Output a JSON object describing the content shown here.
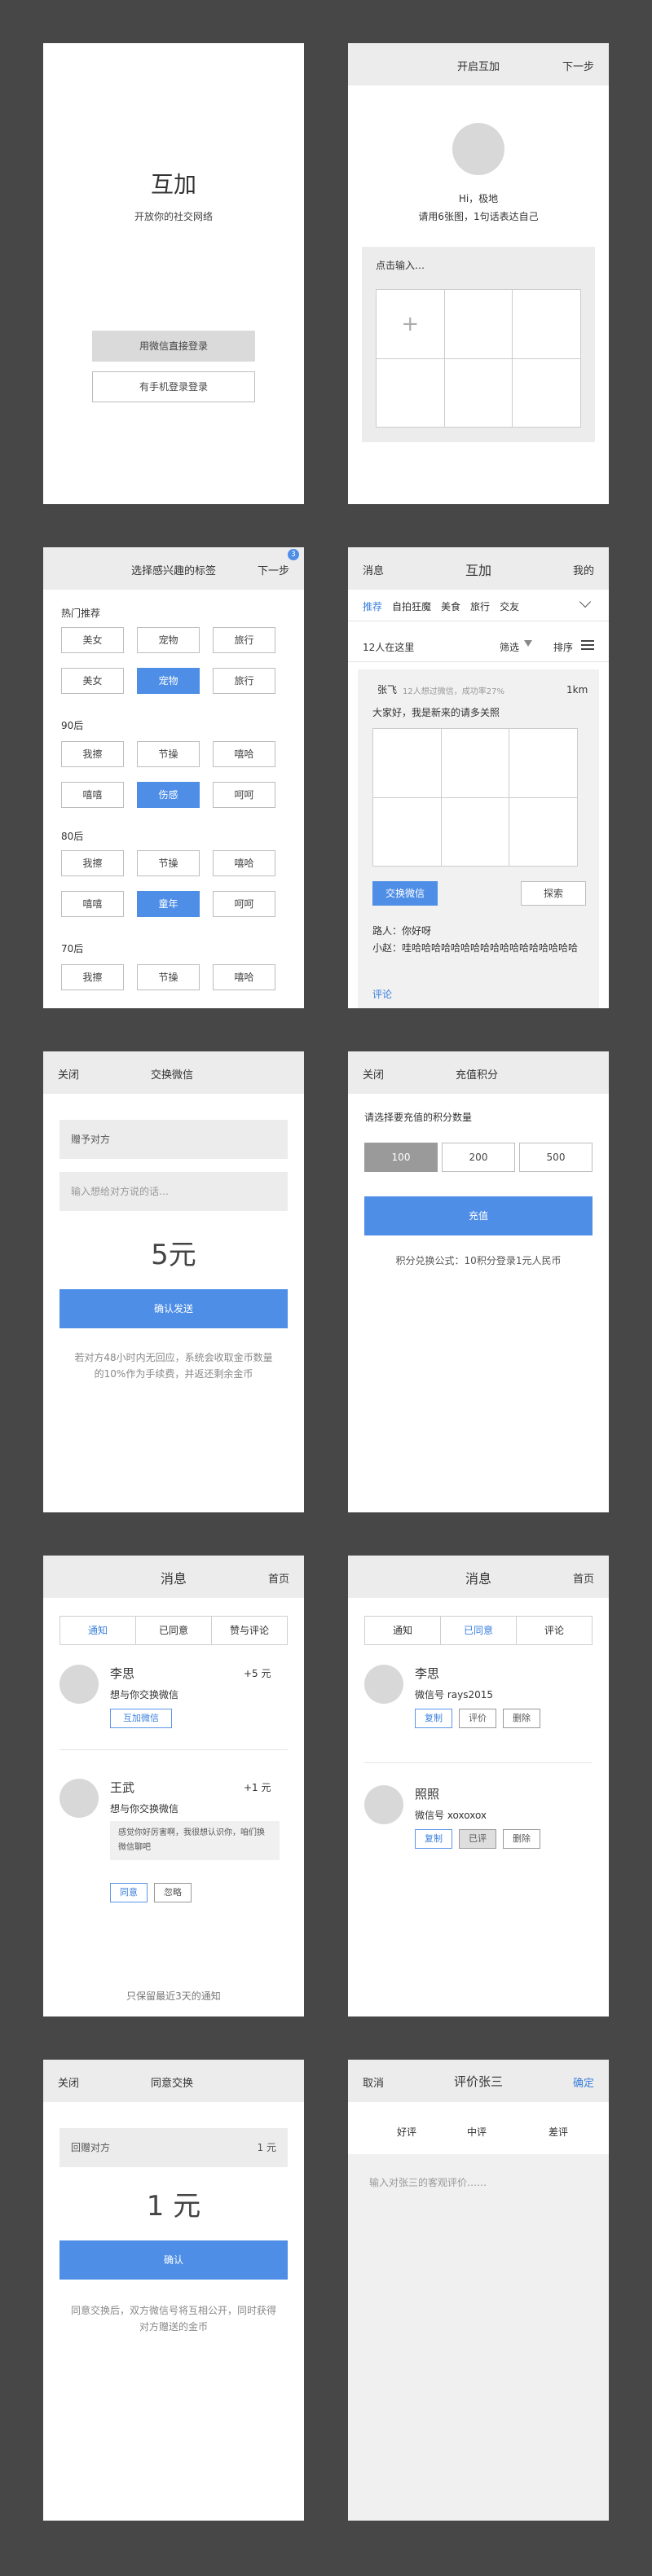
{
  "s1": {
    "title": "互加",
    "subtitle": "开放你的社交网络",
    "wechat_login": "用微信直接登录",
    "phone_login": "有手机登录登录"
  },
  "s2": {
    "bar_title": "开启互加",
    "next": "下一步",
    "greeting": "Hi，极地",
    "prompt": "请用6张图，1句话表达自己",
    "input_placeholder": "点击输入…",
    "plus": "+"
  },
  "s3": {
    "bar_title": "选择感兴趣的标签",
    "next": "下一步",
    "badge": "3",
    "groups": [
      {
        "name": "热门推荐",
        "rows": [
          [
            "美女",
            "宠物",
            "旅行"
          ],
          [
            "美女",
            "宠物",
            "旅行"
          ]
        ]
      },
      {
        "name": "90后",
        "rows": [
          [
            "我擦",
            "节操",
            "嘻哈"
          ],
          [
            "嘻嘻",
            "伤感",
            "呵呵"
          ]
        ]
      },
      {
        "name": "80后",
        "rows": [
          [
            "我擦",
            "节操",
            "嘻哈"
          ],
          [
            "嘻嘻",
            "童年",
            "呵呵"
          ]
        ]
      },
      {
        "name": "70后",
        "rows": [
          [
            "我擦",
            "节操",
            "嘻哈"
          ]
        ]
      }
    ]
  },
  "s4": {
    "left": "消息",
    "title": "互加",
    "right": "我的",
    "tabs": [
      "推荐",
      "自拍狂魔",
      "美食",
      "旅行",
      "交友"
    ],
    "count": "12人在这里",
    "filter": "筛选",
    "sort": "排序",
    "card": {
      "name": "张飞",
      "meta": "12人想过微信，成功率27%",
      "distance": "1km",
      "text": "大家好，我是新来的请多关照",
      "exchange": "交换微信",
      "explore": "探索",
      "comments": [
        "路人：你好呀",
        "小赵：哇哈哈哈哈哈哈哈哈哈哈哈哈哈哈哈哈哈"
      ],
      "comment_link": "评论"
    }
  },
  "s5": {
    "close": "关闭",
    "title": "交换微信",
    "to": "赠予对方",
    "placeholder": "输入想给对方说的话…",
    "price": "5元",
    "send": "确认发送",
    "note": "若对方48小时内无回应，系统会收取金币数量的10%作为手续费，并返还剩余金币"
  },
  "s6": {
    "close": "关闭",
    "title": "充值积分",
    "prompt": "请选择要充值的积分数量",
    "options": [
      "100",
      "200",
      "500"
    ],
    "recharge": "充值",
    "formula": "积分兑换公式：10积分登录1元人民币"
  },
  "s7": {
    "title": "消息",
    "home": "首页",
    "tabs": [
      "通知",
      "已同意",
      "赞与评论"
    ],
    "items": [
      {
        "name": "李思",
        "amount": "+5 元",
        "desc": "想与你交换微信",
        "action": "互加微信"
      },
      {
        "name": "王武",
        "amount": "+1 元",
        "desc": "想与你交换微信",
        "msg": "感觉你好厉害啊，我很想认识你，咱们换微信聊吧",
        "agree": "同意",
        "ignore": "忽略"
      }
    ],
    "footer": "只保留最近3天的通知"
  },
  "s8": {
    "title": "消息",
    "home": "首页",
    "tabs": [
      "通知",
      "已同意",
      "评论"
    ],
    "items": [
      {
        "name": "李思",
        "wechat": "微信号 rays2015",
        "b1": "复制",
        "b2": "评价",
        "b3": "删除"
      },
      {
        "name": "照照",
        "wechat": "微信号 xoxoxox",
        "b1": "复制",
        "b2": "已评",
        "b3": "删除"
      }
    ]
  },
  "s9": {
    "close": "关闭",
    "title": "同意交换",
    "to": "回赠对方",
    "to_amount": "1 元",
    "price": "1 元",
    "confirm": "确认",
    "note": "同意交换后，双方微信号将互相公开，同时获得对方赠送的金币"
  },
  "s10": {
    "cancel": "取消",
    "title": "评价张三",
    "ok": "确定",
    "options": [
      "好评",
      "中评",
      "差评"
    ],
    "placeholder": "输入对张三的客观评价……"
  },
  "colors": {
    "accent": "#4e8ee6",
    "background": "#474747",
    "bar": "#ececec"
  }
}
